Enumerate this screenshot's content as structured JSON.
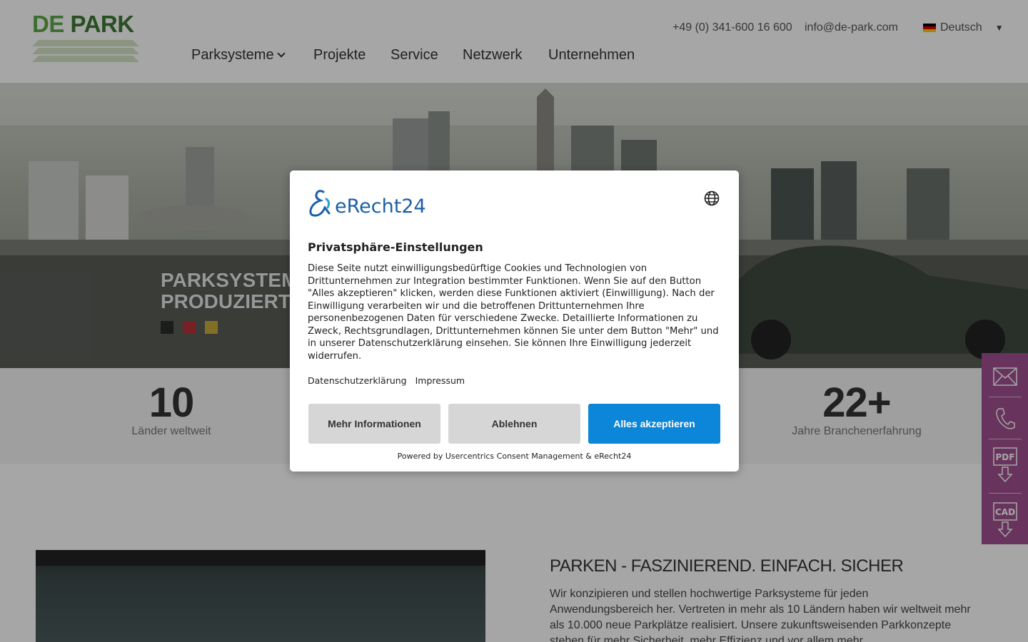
{
  "header": {
    "logo_word1": "DE",
    "logo_word2": "PARK",
    "phone": "+49 (0) 341-600 16 600",
    "email": "info@de-park.com",
    "language": "Deutsch",
    "nav": [
      {
        "label": "Parksysteme"
      },
      {
        "label": "Projekte"
      },
      {
        "label": "Service"
      },
      {
        "label": "Netzwerk"
      },
      {
        "label": "Unternehmen"
      }
    ]
  },
  "hero": {
    "title_line1": "PARKSYSTEM",
    "title_line2": "PRODUZIERT",
    "dot_colors": [
      "#2c2c2c",
      "#b8333a",
      "#c9ad3d"
    ]
  },
  "stats": [
    {
      "number": "10",
      "label": "Länder weltweit"
    },
    {
      "number": "22+",
      "label": "Jahre Branchenerfahrung"
    }
  ],
  "content": {
    "title": "PARKEN - FASZINIEREND. EINFACH. SICHER",
    "text": "Wir konzipieren und stellen hochwertige Parksysteme für jeden Anwendungsbereich her. Vertreten in mehr als 10 Ländern haben wir weltweit mehr als 10.000 neue Parkplätze realisiert. Unsere zukunftsweisenden Parkkonzepte stehen für mehr Sicherheit, mehr Effizienz und vor allem mehr"
  },
  "sidebar": {
    "accent": "#a0508f",
    "pdf_label": "PDF",
    "cad_label": "CAD"
  },
  "consent": {
    "brand": "eRecht24",
    "title": "Privatsphäre-Einstellungen",
    "body": "Diese Seite nutzt einwilligungsbedürftige Cookies und Technologien von Drittunternehmen zur Integration bestimmter Funktionen. Wenn Sie auf den Button \"Alles akzeptieren\" klicken, werden diese Funktionen aktiviert (Einwilligung). Nach der Einwilligung verarbeiten wir und die betroffenen Drittunternehmen Ihre personenbezogenen Daten für verschiedene Zwecke. Detaillierte Informationen zu Zweck, Rechtsgrundlagen, Drittunternehmen können Sie unter dem Button \"Mehr\" und in unserer Datenschutzerklärung einsehen. Sie können Ihre Einwilligung jederzeit widerrufen.",
    "link_privacy": "Datenschutzerklärung",
    "link_imprint": "Impressum",
    "btn_more": "Mehr Informationen",
    "btn_decline": "Ablehnen",
    "btn_accept": "Alles akzeptieren",
    "accent": "#0c86d8",
    "powered": "Powered by Usercentrics Consent Management & eRecht24"
  }
}
